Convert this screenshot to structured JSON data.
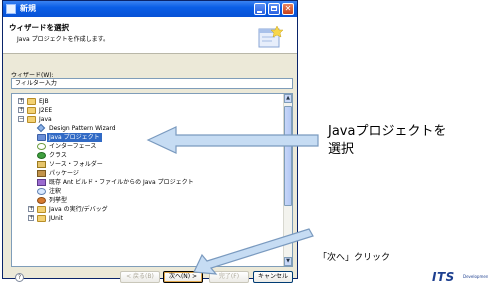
{
  "window": {
    "title": "新規"
  },
  "wizard": {
    "title": "ウィザードを選択",
    "description": "Java プロジェクトを作成します。",
    "label": "ウィザード(W):",
    "filter_value": "フィルター入力"
  },
  "tree": {
    "items": [
      {
        "label": "EJB",
        "icon": "folder-icon",
        "expander": "+"
      },
      {
        "label": "J2EE",
        "icon": "folder-icon",
        "expander": "+"
      },
      {
        "label": "Java",
        "icon": "folder-icon",
        "expander": "−"
      },
      {
        "label": "Design Pattern Wizard",
        "icon": "wizard-icon"
      },
      {
        "label": "Java プロジェクト",
        "icon": "java-project-icon",
        "selected": true
      },
      {
        "label": "インターフェース",
        "icon": "interface-icon"
      },
      {
        "label": "クラス",
        "icon": "class-icon"
      },
      {
        "label": "ソース・フォルダー",
        "icon": "source-folder-icon"
      },
      {
        "label": "パッケージ",
        "icon": "package-icon"
      },
      {
        "label": "既存 Ant ビルド・ファイルからの Java プロジェクト",
        "icon": "ant-project-icon"
      },
      {
        "label": "注釈",
        "icon": "annotation-icon"
      },
      {
        "label": "列挙型",
        "icon": "enum-icon"
      },
      {
        "label": "Java の実行/デバッグ",
        "icon": "folder-icon",
        "expander": "+"
      },
      {
        "label": "JUnit",
        "icon": "folder-icon",
        "expander": "+"
      }
    ]
  },
  "buttons": {
    "help": "?",
    "back": "< 戻る(B)",
    "next": "次へ(N) >",
    "finish": "完了(F)",
    "cancel": "キャンセル"
  },
  "annotations": {
    "callout1_line1": "Javaプロジェクトを",
    "callout1_line2": "選択",
    "callout2": "「次へ」クリック"
  },
  "logo": {
    "text": "ITS",
    "sub": "Development"
  },
  "colors": {
    "titlebar": "#0a5ee6",
    "selection": "#316ac5",
    "arrow_fill": "#c6dcf3",
    "arrow_stroke": "#7a9abf"
  }
}
